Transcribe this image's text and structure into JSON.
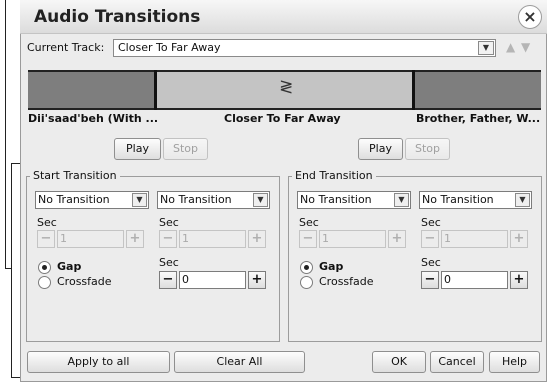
{
  "dialog": {
    "title": "Audio Transitions",
    "close": "×"
  },
  "current_track": {
    "label": "Current Track:",
    "value": "Closer To Far Away",
    "dropdown_icon": "chevron-down",
    "up_icon": "▲",
    "down_icon": "▼"
  },
  "tracks": {
    "left": "Dii'saad'beh (With ...",
    "center": "Closer To Far Away",
    "right": "Brother, Father, W...",
    "join_glyph": "≷"
  },
  "preview_left": {
    "play": "Play",
    "stop": "Stop"
  },
  "preview_right": {
    "play": "Play",
    "stop": "Stop"
  },
  "start_transition": {
    "title": "Start Transition",
    "select_a": "No Transition",
    "select_b": "No Transition",
    "sec_a_label": "Sec",
    "sec_a_value": "1",
    "sec_b_label": "Sec",
    "sec_b_value": "1",
    "radio_gap": "Gap",
    "radio_crossfade": "Crossfade",
    "sec_c_label": "Sec",
    "sec_c_value": "0"
  },
  "end_transition": {
    "title": "End Transition",
    "select_a": "No Transition",
    "select_b": "No Transition",
    "sec_a_label": "Sec",
    "sec_a_value": "1",
    "sec_b_label": "Sec",
    "sec_b_value": "1",
    "radio_gap": "Gap",
    "radio_crossfade": "Crossfade",
    "sec_c_label": "Sec",
    "sec_c_value": "0"
  },
  "stepper": {
    "minus": "−",
    "plus": "+"
  },
  "footer": {
    "apply_all": "Apply to all",
    "clear_all": "Clear All",
    "ok": "OK",
    "cancel": "Cancel",
    "help": "Help"
  }
}
